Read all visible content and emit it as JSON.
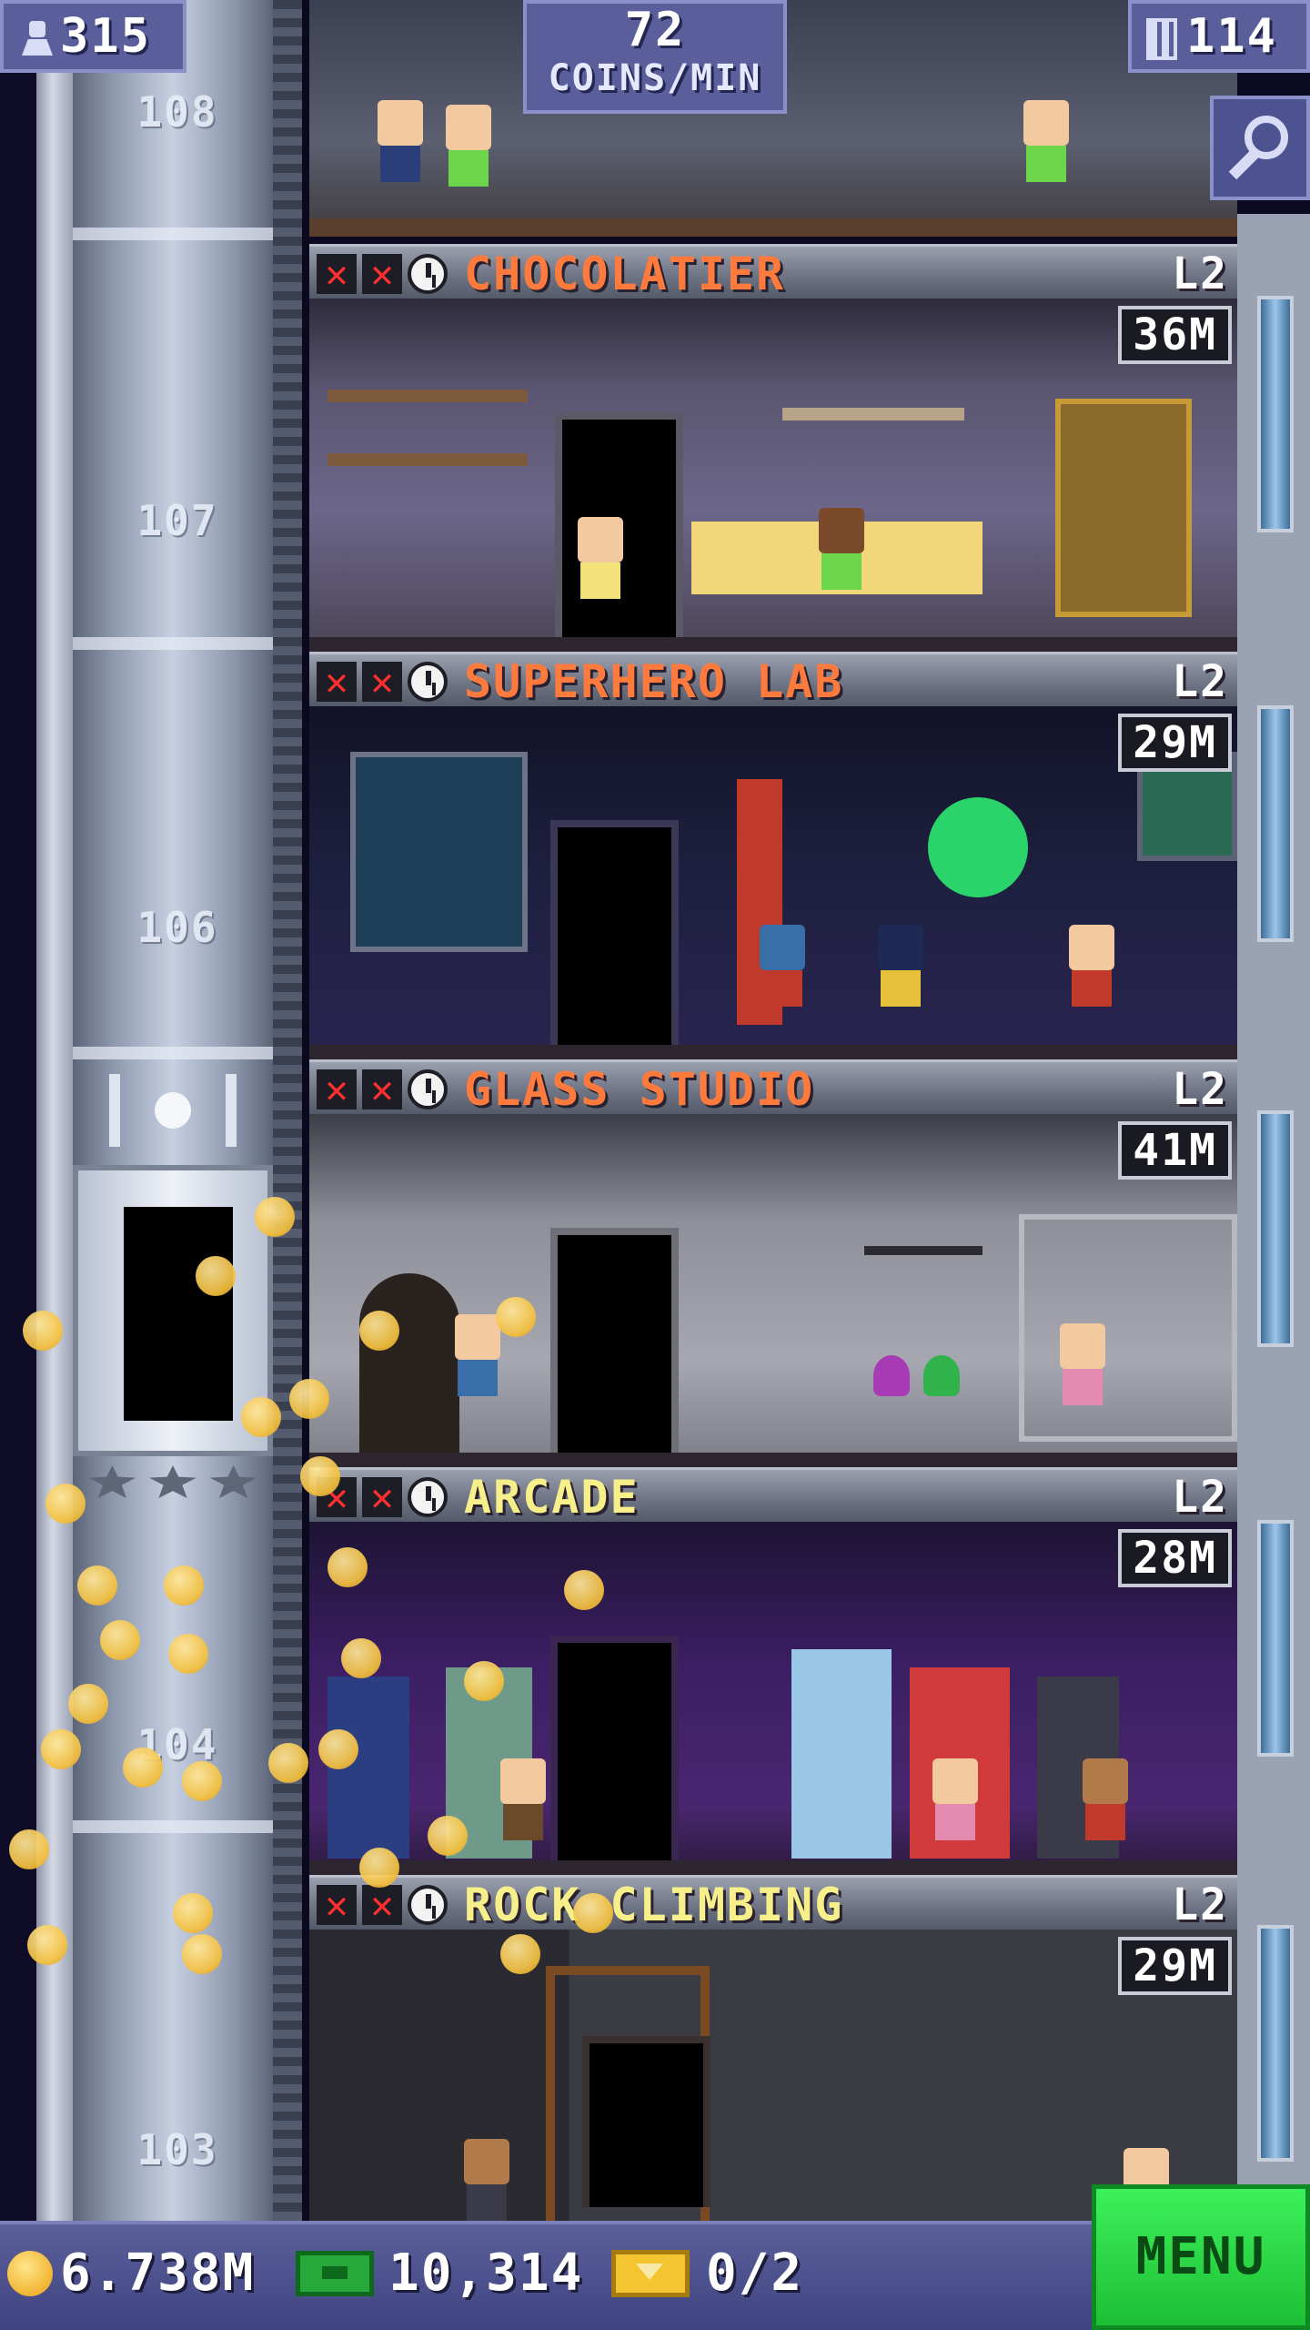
{
  "hud": {
    "population": "315",
    "coins_rate_value": "72",
    "coins_rate_unit": "COINS/MIN",
    "floor_count": "114"
  },
  "shaft": {
    "floor_numbers": [
      "108",
      "107",
      "106",
      "104",
      "103"
    ]
  },
  "floors": [
    {
      "name": "CHOCOLATIER",
      "level": "L2",
      "stock": "36M",
      "name_color": "#ff7a3d"
    },
    {
      "name": "SUPERHERO LAB",
      "level": "L2",
      "stock": "29M",
      "name_color": "#ff7a3d"
    },
    {
      "name": "GLASS STUDIO",
      "level": "L2",
      "stock": "41M",
      "name_color": "#ff7a3d"
    },
    {
      "name": "ARCADE",
      "level": "L2",
      "stock": "28M",
      "name_color": "#f7f08a"
    },
    {
      "name": "ROCK CLIMBING",
      "level": "L2",
      "stock": "29M",
      "name_color": "#f7f08a"
    }
  ],
  "footer": {
    "coins": "6.738M",
    "tower_bux": "10,314",
    "tickets": "0/2",
    "menu_label": "MENU"
  },
  "colors": {
    "accent_green": "#2ddc48",
    "hud_purple": "#5a5f9c",
    "status_x_red": "#ff2f2f"
  },
  "icons": [
    "person-icon",
    "building-icon",
    "search-icon",
    "coin-icon",
    "tower-bux-icon",
    "ticket-icon",
    "clock-icon",
    "x-mark-icon"
  ]
}
